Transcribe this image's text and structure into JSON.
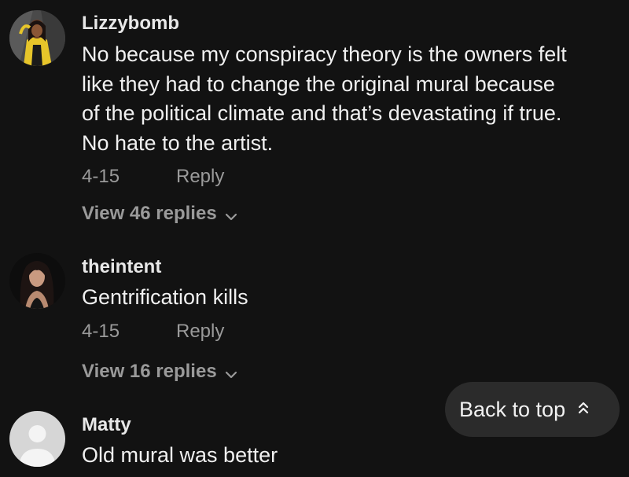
{
  "comments": [
    {
      "username": "Lizzybomb",
      "lines": [
        "No because my conspiracy theory is the owners felt",
        "like they had to change the original mural because",
        "of the political climate and that’s devastating if true.",
        "No hate to the artist."
      ],
      "date": "4-15",
      "reply_label": "Reply",
      "view_replies": "View 46 replies",
      "avatar_icon": "user-photo-avatar"
    },
    {
      "username": "theintent",
      "lines": [
        "Gentrification kills"
      ],
      "date": "4-15",
      "reply_label": "Reply",
      "view_replies": "View 16 replies",
      "avatar_icon": "user-photo-avatar"
    },
    {
      "username": "Matty",
      "lines": [
        "Old mural was better"
      ],
      "avatar_icon": "default-user-avatar"
    }
  ],
  "back_to_top": {
    "label": "Back to top",
    "icon": "double-chevron-up-icon"
  },
  "colors": {
    "background": "#121212",
    "primary_text": "#f0f0f0",
    "secondary_text": "#9a9a9a",
    "button_bg": "#2b2b2b",
    "avatar1_yellow": "#e7c52a"
  }
}
